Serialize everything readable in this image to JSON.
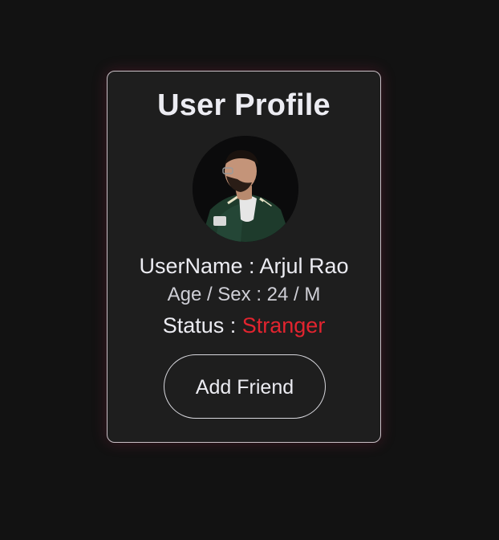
{
  "profile": {
    "title": "User Profile",
    "username_label": "UserName : ",
    "username_value": "Arjul Rao",
    "age_sex_label": "Age / Sex : ",
    "age_value": "24",
    "separator": " / ",
    "sex_value": "M",
    "status_label": "Status : ",
    "status_value": "Stranger",
    "button_label": "Add Friend"
  },
  "colors": {
    "background": "#121212",
    "card": "#1e1e1e",
    "status_accent": "#e2242f"
  }
}
